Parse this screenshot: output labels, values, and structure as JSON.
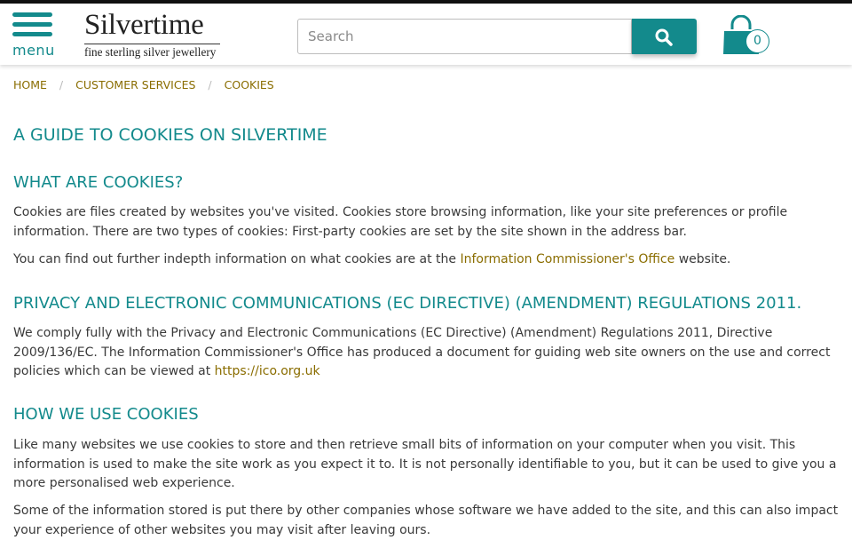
{
  "header": {
    "menu_label": "menu",
    "brand": "Silvertime",
    "tagline": "fine sterling silver jewellery",
    "search_placeholder": "Search",
    "cart_count": "0",
    "accent_color": "#138a8c"
  },
  "breadcrumb": [
    "HOME",
    "CUSTOMER SERVICES",
    "COOKIES"
  ],
  "content": {
    "title": "A GUIDE TO COOKIES ON SILVERTIME",
    "sections": {
      "what": {
        "heading": "WHAT ARE COOKIES?",
        "p1": "Cookies are files created by websites you've visited. Cookies store browsing information, like your site preferences or profile information. There are two types of cookies: First-party cookies are set by the site shown in the address bar.",
        "p2_before": "You can find out further indepth information on what cookies are at the ",
        "p2_link": "Information Commissioner's Office",
        "p2_after": " website."
      },
      "privacy": {
        "heading": "PRIVACY AND ELECTRONIC COMMUNICATIONS (EC DIRECTIVE) (AMENDMENT) REGULATIONS 2011.",
        "p1_before": "We comply fully with the Privacy and Electronic Communications (EC Directive) (Amendment) Regulations 2011, Directive 2009/136/EC. The Information Commissioner's Office has produced a document for guiding web site owners on the use and correct policies which can be viewed at ",
        "p1_link": "https://ico.org.uk"
      },
      "how": {
        "heading": "HOW WE USE COOKIES",
        "p1": "Like many websites we use cookies to store and then retrieve small bits of information on your computer when you visit. This information is used to make the site work as you expect it to. It is not personally identifiable to you, but it can be used to give you a more personalised web experience.",
        "p2": "Some of the information stored is put there by other companies whose software we have added to the site, and this can also impact your experience of other websites you may visit after leaving ours."
      }
    }
  }
}
